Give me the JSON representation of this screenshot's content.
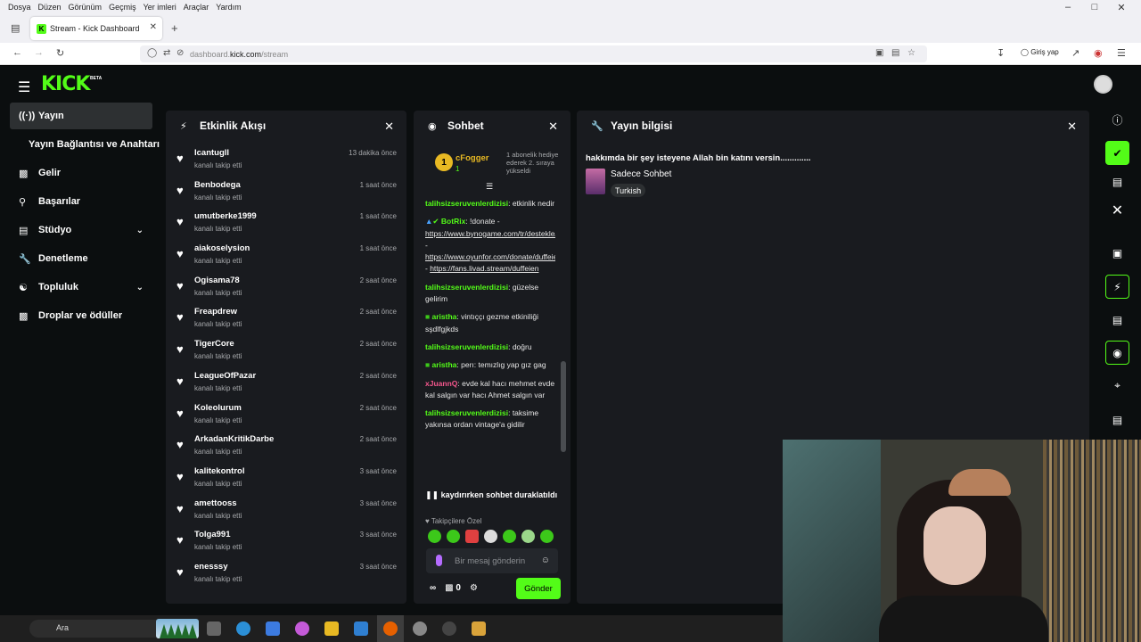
{
  "browser": {
    "menu": [
      "Dosya",
      "Düzen",
      "Görünüm",
      "Geçmiş",
      "Yer imleri",
      "Araçlar",
      "Yardım"
    ],
    "tab_title": "Stream - Kick Dashboard",
    "url_prefix": "dashboard.",
    "url_domain": "kick.com",
    "url_path": "/stream",
    "signin_label": "Giriş yap"
  },
  "app": {
    "logo": "KICK",
    "beta": "BETA"
  },
  "sidebar": {
    "items": [
      {
        "label": "Yayın",
        "icon": "broadcast-icon"
      },
      {
        "label": "Gelir",
        "icon": "chart-icon"
      },
      {
        "label": "Başarılar",
        "icon": "trophy-icon"
      },
      {
        "label": "Stüdyo",
        "icon": "studio-icon"
      },
      {
        "label": "Denetleme",
        "icon": "wrench-icon"
      },
      {
        "label": "Topluluk",
        "icon": "users-icon"
      },
      {
        "label": "Droplar ve ödüller",
        "icon": "gift-icon"
      }
    ],
    "sub_item": "Yayın Bağlantısı ve Anahtarı"
  },
  "activity": {
    "title": "Etkinlik Akışı",
    "items": [
      {
        "name": "Icantugll",
        "action": "kanalı takip etti",
        "time": "13 dakika önce"
      },
      {
        "name": "Benbodega",
        "action": "kanalı takip etti",
        "time": "1 saat önce"
      },
      {
        "name": "umutberke1999",
        "action": "kanalı takip etti",
        "time": "1 saat önce"
      },
      {
        "name": "aiakoselysion",
        "action": "kanalı takip etti",
        "time": "1 saat önce"
      },
      {
        "name": "Ogisama78",
        "action": "kanalı takip etti",
        "time": "2 saat önce"
      },
      {
        "name": "Freapdrew",
        "action": "kanalı takip etti",
        "time": "2 saat önce"
      },
      {
        "name": "TigerCore",
        "action": "kanalı takip etti",
        "time": "2 saat önce"
      },
      {
        "name": "LeagueOfPazar",
        "action": "kanalı takip etti",
        "time": "2 saat önce"
      },
      {
        "name": "Koleolurum",
        "action": "kanalı takip etti",
        "time": "2 saat önce"
      },
      {
        "name": "ArkadanKritikDarbe",
        "action": "kanalı takip etti",
        "time": "2 saat önce"
      },
      {
        "name": "kalitekontrol",
        "action": "kanalı takip etti",
        "time": "3 saat önce"
      },
      {
        "name": "amettooss",
        "action": "kanalı takip etti",
        "time": "3 saat önce"
      },
      {
        "name": "Tolga991",
        "action": "kanalı takip etti",
        "time": "3 saat önce"
      },
      {
        "name": "enesssy",
        "action": "kanalı takip etti",
        "time": "3 saat önce"
      }
    ]
  },
  "chat": {
    "title": "Sohbet",
    "gift": {
      "rank": "1",
      "user": "cFogger",
      "count": "1",
      "text": "1 abonelik hediye ederek 2. sıraya yükseldi"
    },
    "messages": [
      {
        "user": "talihsizseruvenlerdizisi",
        "color": "#53fc18",
        "text": "etkinlik nedir"
      },
      {
        "user": "BotRix",
        "color": "#53fc18",
        "text": "!donate - ",
        "links": [
          "https://www.bynogame.com/tr/destekle/duffeien",
          "https://www.oyunfor.com/donate/duffeien",
          "https://fans.livad.stream/duffeien"
        ]
      },
      {
        "user": "talihsizseruvenlerdizisi",
        "color": "#53fc18",
        "text": "güzelse gelirim"
      },
      {
        "user": "aristha",
        "color": "#53fc18",
        "text": "vintıççı gezme etkiniliği sşdlfgjkds"
      },
      {
        "user": "talihsizseruvenlerdizisi",
        "color": "#53fc18",
        "text": "doğru"
      },
      {
        "user": "aristha",
        "color": "#53fc18",
        "text": "perı: temızlıg yap gız gag"
      },
      {
        "user": "xJuannQ",
        "color": "#f5578d",
        "text": "evde kal hacı mehmet evde kal salgın var hacı Ahmet salgın var"
      },
      {
        "user": "talihsizseruvenlerdizisi",
        "color": "#53fc18",
        "text": "taksime yakınsa ordan vintage'a gidilir"
      }
    ],
    "paused_label": "kaydırırken sohbet duraklatıldı",
    "follower_only": "Takipçilere Özel",
    "input_placeholder": "Bir mesaj gönderin",
    "kicks_count": "0",
    "send_label": "Gönder",
    "accent": "#53fc18"
  },
  "stream_info": {
    "title_label": "Yayın bilgisi",
    "stream_title": "hakkımda bir şey isteyene Allah bin katını versin.............",
    "category": "Sadece Sohbet",
    "language": "Turkish"
  },
  "taskbar": {
    "search_text": "Ara"
  }
}
